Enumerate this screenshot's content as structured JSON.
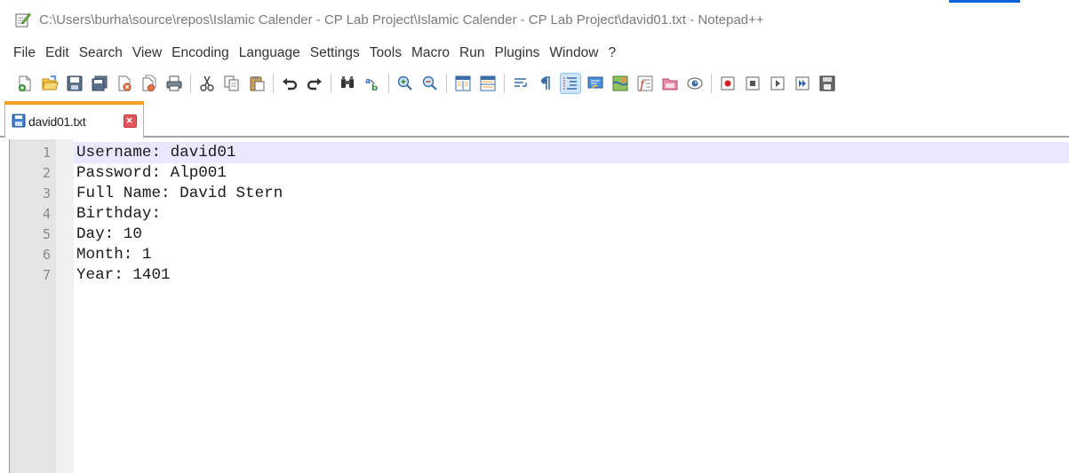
{
  "window": {
    "title": "C:\\Users\\burha\\source\\repos\\Islamic Calender - CP Lab Project\\Islamic Calender - CP Lab Project\\david01.txt - Notepad++",
    "app_icon": "notepadpp-icon",
    "accent_color": "#0a64d6"
  },
  "menu": {
    "items": [
      "File",
      "Edit",
      "Search",
      "View",
      "Encoding",
      "Language",
      "Settings",
      "Tools",
      "Macro",
      "Run",
      "Plugins",
      "Window",
      "?"
    ]
  },
  "toolbar": {
    "buttons": [
      "new-file-icon",
      "open-file-icon",
      "save-icon",
      "save-all-icon",
      "close-icon",
      "close-all-icon",
      "print-icon",
      "cut-icon",
      "copy-icon",
      "paste-icon",
      "undo-icon",
      "redo-icon",
      "find-icon",
      "replace-icon",
      "zoom-in-icon",
      "zoom-out-icon",
      "sync-vertical-icon",
      "sync-horizontal-icon",
      "word-wrap-icon",
      "show-all-chars-icon",
      "indent-guide-icon",
      "udl-icon",
      "doc-map-icon",
      "function-list-icon",
      "folder-as-workspace-icon",
      "monitoring-icon",
      "record-macro-icon",
      "stop-macro-icon",
      "play-macro-icon",
      "run-macro-multiple-icon",
      "save-macro-icon"
    ],
    "active_button": "indent-guide-icon"
  },
  "tabs": [
    {
      "label": "david01.txt",
      "icon": "saved-file-icon",
      "close_icon": "tab-close-icon",
      "active": true
    }
  ],
  "editor": {
    "current_line": 1,
    "lines": [
      {
        "number": "1",
        "text": "Username: david01"
      },
      {
        "number": "2",
        "text": "Password: Alp001"
      },
      {
        "number": "3",
        "text": "Full Name: David Stern"
      },
      {
        "number": "4",
        "text": "Birthday:"
      },
      {
        "number": "5",
        "text": "Day: 10"
      },
      {
        "number": "6",
        "text": "Month: 1"
      },
      {
        "number": "7",
        "text": "Year: 1401"
      }
    ]
  }
}
